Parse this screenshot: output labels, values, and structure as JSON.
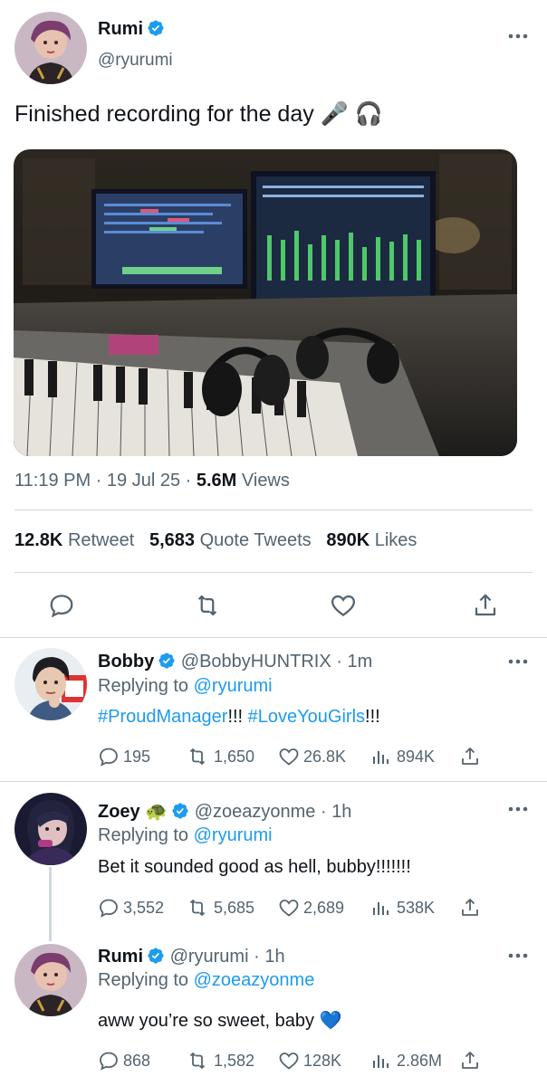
{
  "main": {
    "name": "Rumi",
    "handle": "@ryurumi",
    "text": "Finished recording for the day 🎤 🎧",
    "time": "11:19 PM",
    "date": "19 Jul 25",
    "views_count": "5.6M",
    "views_label": "Views",
    "retweets": "12.8K",
    "retweets_label": "Retweet",
    "quotes": "5,683",
    "quotes_label": "Quote Tweets",
    "likes": "890K",
    "likes_label": "Likes"
  },
  "replies": [
    {
      "name": "Bobby",
      "handle": "@BobbyHUNTRIX",
      "time": "1m",
      "replying_label": "Replying to",
      "replying_to": "@ryurumi",
      "text_parts": [
        "#ProudManager",
        "!!! ",
        "#LoveYouGirls",
        "!!!"
      ],
      "comments": "195",
      "retweets": "1,650",
      "likes": "26.8K",
      "views": "894K"
    },
    {
      "name": "Zoey 🐢",
      "handle": "@zoeazyonme",
      "time": "1h",
      "replying_label": "Replying to",
      "replying_to": "@ryurumi",
      "text": "Bet it sounded good as hell, bubby!!!!!!!",
      "comments": "3,552",
      "retweets": "5,685",
      "likes": "2,689",
      "views": "538K"
    },
    {
      "name": "Rumi",
      "handle": "@ryurumi",
      "time": "1h",
      "replying_label": "Replying to",
      "replying_to": "@zoeazyonme",
      "text": "aww you’re so sweet, baby 💙",
      "comments": "868",
      "retweets": "1,582",
      "likes": "128K",
      "views": "2.86M"
    }
  ],
  "colors": {
    "accent": "#1d9bf0",
    "text": "#0f1419",
    "secondary": "#536471",
    "border": "#cfd9de"
  }
}
